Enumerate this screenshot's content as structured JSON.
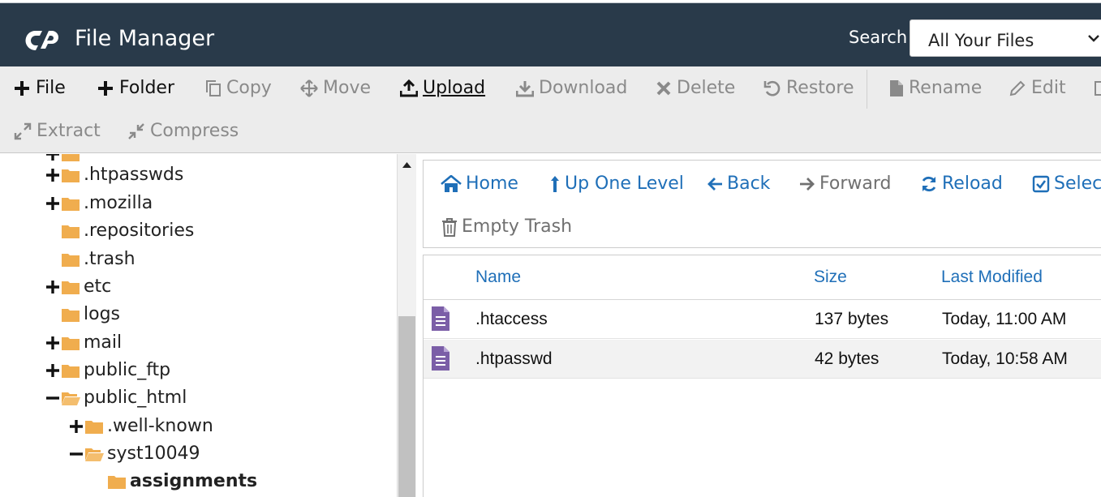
{
  "header": {
    "app_title": "File Manager",
    "search_label": "Search",
    "search_scope": "All Your Files",
    "background": "#293a4a"
  },
  "toolbar": {
    "buttons": [
      {
        "label": "File",
        "icon": "plus-icon",
        "enabled": true
      },
      {
        "label": "Folder",
        "icon": "plus-icon",
        "enabled": true
      },
      {
        "label": "Copy",
        "icon": "copy-icon",
        "enabled": false
      },
      {
        "label": "Move",
        "icon": "move-icon",
        "enabled": false
      },
      {
        "label": "Upload",
        "icon": "upload-icon",
        "enabled": true
      },
      {
        "label": "Download",
        "icon": "download-icon",
        "enabled": false
      },
      {
        "label": "Delete",
        "icon": "delete-icon",
        "enabled": false
      },
      {
        "label": "Restore",
        "icon": "restore-icon",
        "enabled": false
      },
      {
        "label": "Rename",
        "icon": "file-icon",
        "enabled": false
      },
      {
        "label": "Edit",
        "icon": "pencil-icon",
        "enabled": false
      },
      {
        "label": "Extract",
        "icon": "expand-icon",
        "enabled": false
      },
      {
        "label": "Compress",
        "icon": "compress-icon",
        "enabled": false
      }
    ]
  },
  "tree": {
    "items": [
      {
        "label": ".htpasswds",
        "toggle": "plus",
        "open": false,
        "bold": false
      },
      {
        "label": ".mozilla",
        "toggle": "plus",
        "open": false,
        "bold": false
      },
      {
        "label": ".repositories",
        "toggle": "none",
        "open": false,
        "bold": false
      },
      {
        "label": ".trash",
        "toggle": "none",
        "open": false,
        "bold": false
      },
      {
        "label": "etc",
        "toggle": "plus",
        "open": false,
        "bold": false
      },
      {
        "label": "logs",
        "toggle": "none",
        "open": false,
        "bold": false
      },
      {
        "label": "mail",
        "toggle": "plus",
        "open": false,
        "bold": false
      },
      {
        "label": "public_ftp",
        "toggle": "plus",
        "open": false,
        "bold": false
      },
      {
        "label": "public_html",
        "toggle": "minus",
        "open": true,
        "bold": false
      },
      {
        "label": ".well-known",
        "toggle": "plus",
        "open": false,
        "bold": false
      },
      {
        "label": "syst10049",
        "toggle": "minus",
        "open": true,
        "bold": false
      },
      {
        "label": "assignments",
        "toggle": "none",
        "open": false,
        "bold": true
      }
    ]
  },
  "nav": {
    "buttons": [
      {
        "label": "Home",
        "icon": "home-icon",
        "enabled": true
      },
      {
        "label": "Up One Level",
        "icon": "level-up-icon",
        "enabled": true
      },
      {
        "label": "Back",
        "icon": "arrow-left-icon",
        "enabled": true
      },
      {
        "label": "Forward",
        "icon": "arrow-right-icon",
        "enabled": false
      },
      {
        "label": "Reload",
        "icon": "reload-icon",
        "enabled": true
      },
      {
        "label": "Select",
        "icon": "checkbox-icon",
        "enabled": true
      },
      {
        "label": "Empty Trash",
        "icon": "trash-icon",
        "enabled": false
      }
    ]
  },
  "table": {
    "columns": {
      "name": "Name",
      "size": "Size",
      "modified": "Last Modified"
    },
    "rows": [
      {
        "name": ".htaccess",
        "size": "137 bytes",
        "modified": "Today, 11:00 AM",
        "icon": "text-file-icon"
      },
      {
        "name": ".htpasswd",
        "size": "42 bytes",
        "modified": "Today, 10:58 AM",
        "icon": "text-file-icon"
      }
    ]
  },
  "colors": {
    "link": "#1f6fb8",
    "folder": "#f0ad4e",
    "file_icon": "#7b5ea7",
    "disabled": "#8a8a8a"
  }
}
